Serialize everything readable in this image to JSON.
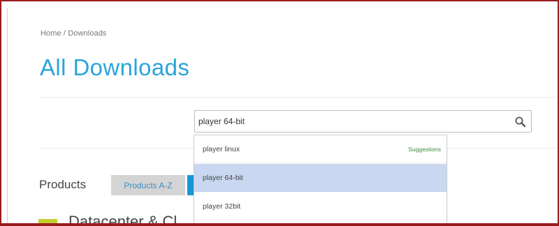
{
  "breadcrumb": "Home / Downloads",
  "title": "All Downloads",
  "search": {
    "value": "player 64-bit",
    "icon": "magnifier"
  },
  "suggestions": {
    "header_label": "Suggestions",
    "items": [
      {
        "label": "player linux"
      },
      {
        "label": "player 64-bit",
        "highlighted": true
      },
      {
        "label": "player 32bit"
      }
    ]
  },
  "products": {
    "heading": "Products",
    "tabs": [
      {
        "label": "Products A-Z"
      }
    ],
    "category_partial": "Datacenter & Cl"
  },
  "colors": {
    "accent": "#2ba4d9",
    "frame": "#9b1c1c",
    "highlight": "#c9d7f0",
    "suggestions_green": "#3d8b3d",
    "category_icon": "#c3cf2a"
  }
}
